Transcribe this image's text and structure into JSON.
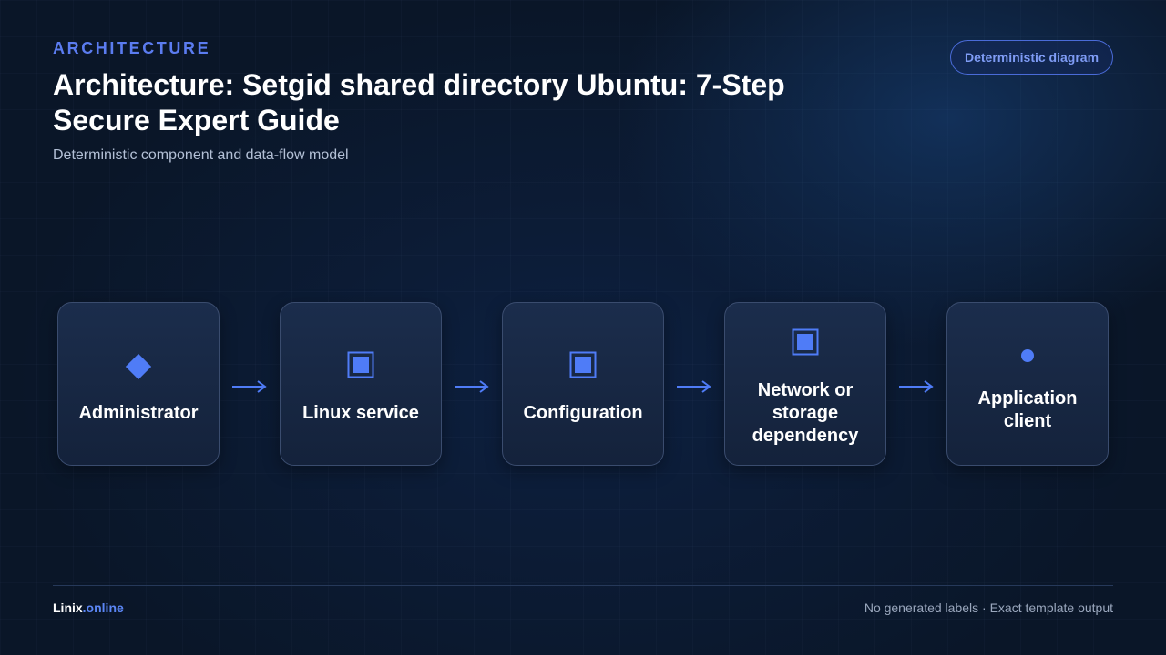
{
  "header": {
    "eyebrow": "ARCHITECTURE",
    "title": "Architecture: Setgid shared directory Ubuntu: 7-Step Secure Expert Guide",
    "subtitle": "Deterministic component and data-flow model",
    "badge": "Deterministic diagram"
  },
  "flow": {
    "nodes": [
      {
        "label": "Administrator",
        "icon": "diamond-icon"
      },
      {
        "label": "Linux service",
        "icon": "square-node-icon"
      },
      {
        "label": "Configuration",
        "icon": "square-node-icon"
      },
      {
        "label": "Network or storage dependency",
        "icon": "square-node-icon"
      },
      {
        "label": "Application client",
        "icon": "dot-icon"
      }
    ],
    "edges": [
      {
        "from": "Administrator",
        "to": "Linux service",
        "icon": "arrow-right-icon"
      },
      {
        "from": "Linux service",
        "to": "Configuration",
        "icon": "arrow-right-icon"
      },
      {
        "from": "Configuration",
        "to": "Network or storage dependency",
        "icon": "arrow-right-icon"
      },
      {
        "from": "Network or storage dependency",
        "to": "Application client",
        "icon": "arrow-right-icon"
      }
    ]
  },
  "footer": {
    "brand_name": "Linix",
    "brand_tld": ".online",
    "note": "No generated labels · Exact template output"
  },
  "colors": {
    "accent": "#4f7cf7",
    "background": "#0a1628",
    "node_fill": "#182842",
    "node_border": "#3a4c6e"
  }
}
